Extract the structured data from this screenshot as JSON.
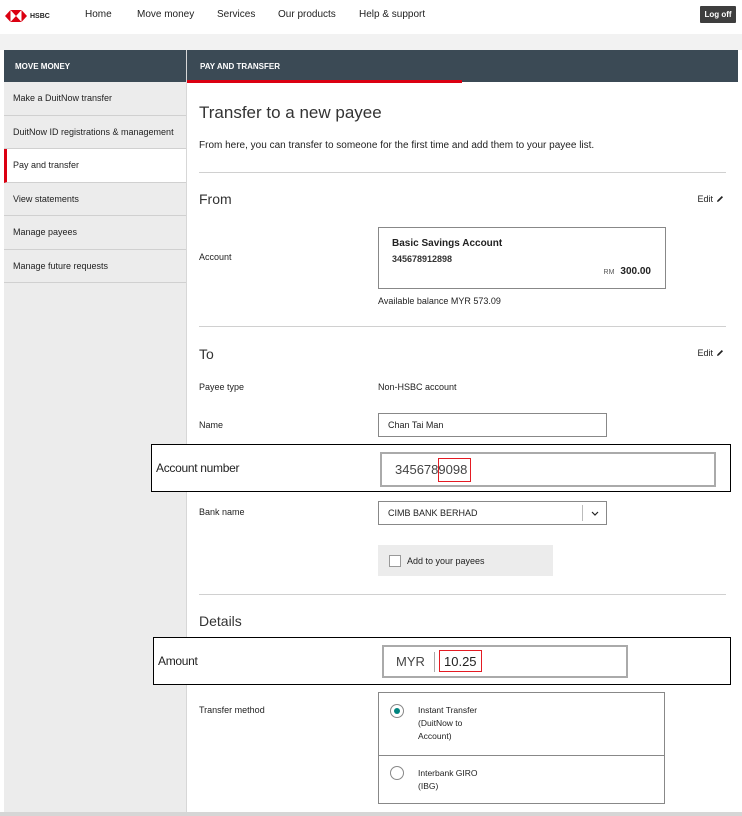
{
  "brand": {
    "logo_text": "HSBC",
    "accent": "#db0011",
    "header_bg": "#3b4a55"
  },
  "topnav": {
    "items": [
      "Home",
      "Move money",
      "Services",
      "Our products",
      "Help & support"
    ],
    "logoff_label": "Log off"
  },
  "sidebar": {
    "title": "MOVE MONEY",
    "items": [
      "Make a DuitNow transfer",
      "DuitNow ID registrations & management",
      "Pay and transfer",
      "View statements",
      "Manage payees",
      "Manage future requests"
    ],
    "active_index": 2
  },
  "main": {
    "tab_label": "PAY AND TRANSFER",
    "title": "Transfer to a new payee",
    "intro": "From here, you can transfer to someone for the first time and add them to your payee list."
  },
  "from": {
    "section_title": "From",
    "edit_label": "Edit",
    "account_label": "Account",
    "account_name": "Basic Savings Account",
    "account_number": "345678912898",
    "currency": "RM",
    "amount": "300.00",
    "available_balance": "Available balance MYR 573.09"
  },
  "to": {
    "section_title": "To",
    "edit_label": "Edit",
    "payee_type_label": "Payee type",
    "payee_type_value": "Non-HSBC account",
    "name_label": "Name",
    "name_value": "Chan Tai Man",
    "account_number_label": "Account number",
    "account_number_value_prefix": "3456789",
    "account_number_value_highlight": "098",
    "bank_name_label": "Bank name",
    "bank_name_value": "CIMB BANK BERHAD",
    "add_payee_label": "Add to your payees"
  },
  "details": {
    "section_title": "Details",
    "amount_label": "Amount",
    "amount_currency": "MYR",
    "amount_value": "10.25",
    "transfer_method_label": "Transfer method",
    "methods": [
      {
        "line1": "Instant Transfer",
        "line2": "(DuitNow to",
        "line3": "Account)",
        "selected": true
      },
      {
        "line1": "Interbank GIRO",
        "line2": "(IBG)",
        "selected": false
      }
    ]
  }
}
